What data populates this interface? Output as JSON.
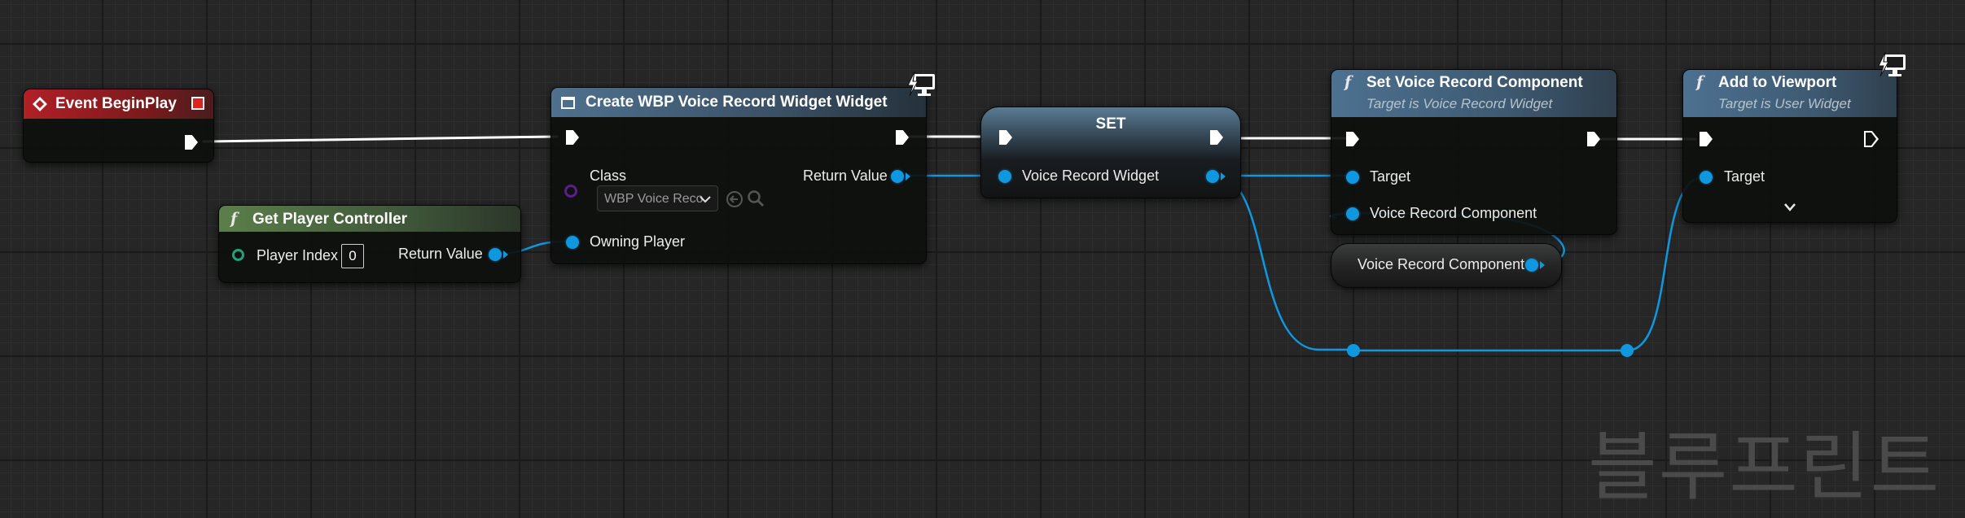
{
  "nodes": {
    "event_begin_play": {
      "title": "Event BeginPlay"
    },
    "get_player_controller": {
      "fx": "f",
      "title": "Get Player Controller",
      "player_index_label": "Player Index",
      "player_index_value": "0",
      "return_value_label": "Return Value"
    },
    "create_widget": {
      "title": "Create WBP Voice Record Widget Widget",
      "class_label": "Class",
      "class_value": "WBP Voice Reco",
      "owning_player_label": "Owning Player",
      "return_value_label": "Return Value"
    },
    "set": {
      "title": "SET",
      "voice_record_widget_label": "Voice Record Widget"
    },
    "set_voice_record_component": {
      "fx": "f",
      "title": "Set Voice Record Component",
      "subtitle": "Target is Voice Record Widget",
      "target_label": "Target",
      "voice_record_component_label": "Voice Record Component"
    },
    "voice_record_component_getter": {
      "title": "Voice Record Component"
    },
    "add_to_viewport": {
      "fx": "f",
      "title": "Add to Viewport",
      "subtitle": "Target is User Widget",
      "target_label": "Target"
    }
  },
  "watermark": "블루프린트",
  "colors": {
    "background": "#262626",
    "exec_wire": "#ffffff",
    "object_pin": "#0f98e0",
    "event_header": "#b02027",
    "function_header": "#4d7191",
    "pure_function_header": "#5b7f4a",
    "class_pin": "#5a1e8c",
    "struct_pin": "#1fa37a"
  },
  "icons": [
    "event-diamond-icon",
    "stop-square-icon",
    "function-icon",
    "widget-icon",
    "monitor-lightning-icon",
    "chevron-down-icon",
    "browse-arrow-icon",
    "search-icon",
    "exec-pin-icon",
    "object-pin-icon"
  ]
}
